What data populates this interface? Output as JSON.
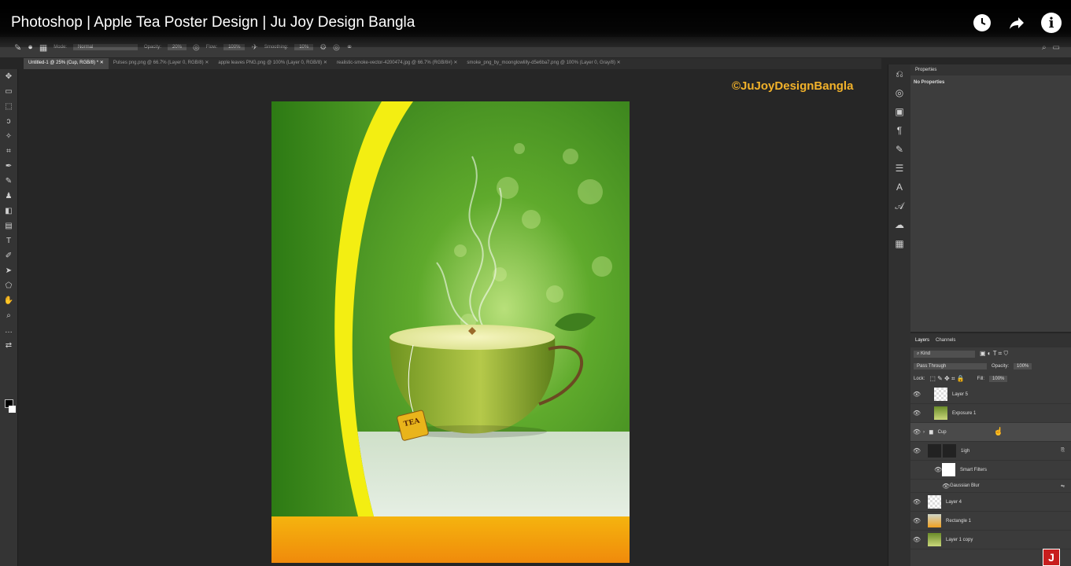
{
  "video": {
    "title": "Photoshop | Apple Tea Poster Design | Ju Joy Design Bangla",
    "icons": [
      "clock-icon",
      "share-icon",
      "info-icon"
    ]
  },
  "options_bar": {
    "mode_label": "Mode:",
    "mode_value": "Normal",
    "opacity_label": "Opacity:",
    "opacity_value": "20%",
    "flow_label": "Flow:",
    "flow_value": "100%",
    "smoothing_label": "Smoothing:",
    "smoothing_value": "10%"
  },
  "tabs": [
    {
      "label": "Untitled-1 @ 25% (Cup, RGB/8) *"
    },
    {
      "label": "Pulses png.png @ 66.7% (Layer 0, RGB/8)"
    },
    {
      "label": "apple leaves PNG.png @ 100% (Layer 0, RGB/8)"
    },
    {
      "label": "realistic-smoke-vector-4200474.jpg @ 66.7% (RGB/8#)"
    },
    {
      "label": "smoke_png_by_moonglowlilly-d5e6ba7.png @ 100% (Layer 0, Gray/8)"
    }
  ],
  "canvas": {
    "watermark": "©JuJoyDesignBangla",
    "teabag_label": "TEA"
  },
  "properties": {
    "title": "Properties",
    "empty": "No Properties"
  },
  "layers": {
    "tabs": [
      "Layers",
      "Channels"
    ],
    "filter_kind": "Kind",
    "blend_mode": "Pass Through",
    "opacity_label": "Opacity:",
    "opacity_value": "100%",
    "lock_label": "Lock:",
    "fill_label": "Fill:",
    "fill_value": "100%",
    "items": [
      {
        "name": "Layer 5"
      },
      {
        "name": "Exposure 1"
      },
      {
        "name": "Cup"
      },
      {
        "name": "1igh"
      },
      {
        "name": "Smart Filters"
      },
      {
        "name": "Gaussian Blur"
      },
      {
        "name": "Layer 4"
      },
      {
        "name": "Rectangle 1"
      },
      {
        "name": "Layer 1 copy"
      }
    ]
  },
  "channel_logo": "J"
}
